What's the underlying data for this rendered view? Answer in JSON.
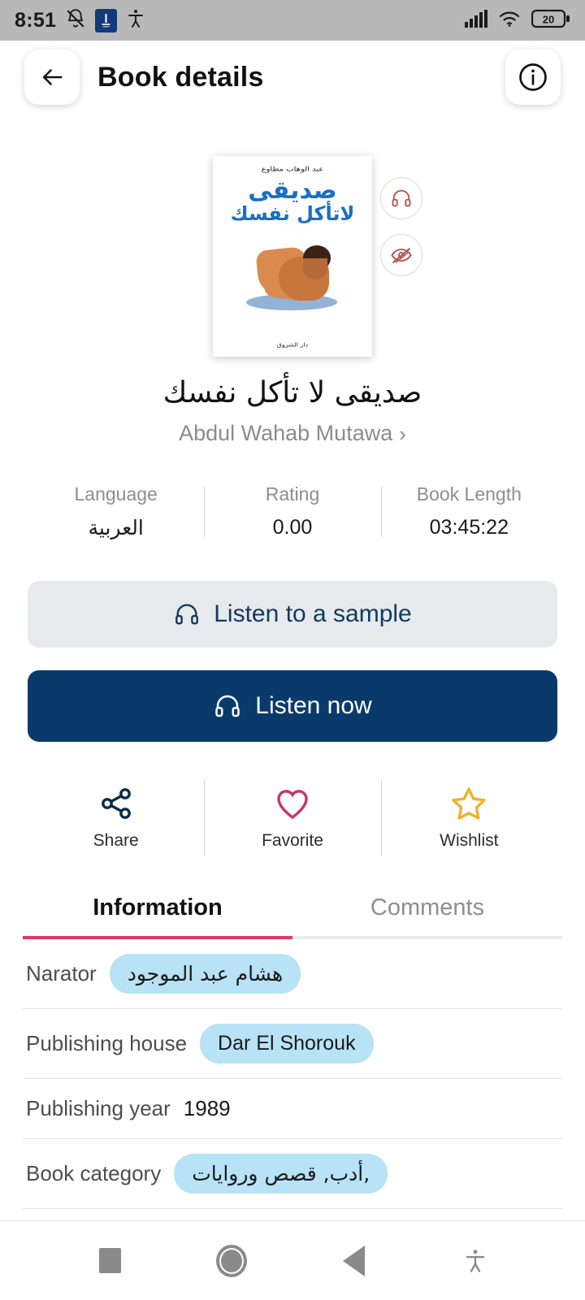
{
  "statusbar": {
    "time": "8:51",
    "icons": [
      "bell-muted-icon",
      "app-badge-icon",
      "accessibility-icon"
    ],
    "signal_icon": "cellular-signal-icon",
    "wifi_icon": "wifi-icon",
    "battery_level": "20"
  },
  "header": {
    "back_icon": "back-arrow-icon",
    "title": "Book details",
    "info_icon": "info-icon"
  },
  "cover": {
    "author_line": "عبد الوهاب مطاوع",
    "title_line1": "صديقى",
    "title_line2": "لاتأكل نفسك",
    "publisher_line": "دار الشروق",
    "side_actions": [
      {
        "name": "headphones-icon",
        "label": "audio-available"
      },
      {
        "name": "eye-off-icon",
        "label": "hide-preview"
      }
    ]
  },
  "book": {
    "title": "صديقى لا تأكل نفسك",
    "author": "Abdul Wahab Mutawa",
    "author_chevron": "›"
  },
  "stats": [
    {
      "label": "Language",
      "value": "العربية"
    },
    {
      "label": "Rating",
      "value": "0.00"
    },
    {
      "label": "Book Length",
      "value": "03:45:22"
    }
  ],
  "buttons": {
    "sample": {
      "label": "Listen to a sample",
      "icon": "headphones-icon"
    },
    "now": {
      "label": "Listen now",
      "icon": "headphones-icon"
    }
  },
  "actions": [
    {
      "label": "Share",
      "icon": "share-icon",
      "color": "#0d2b4a"
    },
    {
      "label": "Favorite",
      "icon": "heart-icon",
      "color": "#c9346b"
    },
    {
      "label": "Wishlist",
      "icon": "star-icon",
      "color": "#efb033"
    }
  ],
  "tabs": [
    {
      "label": "Information",
      "active": true
    },
    {
      "label": "Comments",
      "active": false
    }
  ],
  "info_rows": [
    {
      "label": "Narator",
      "value": "هشام عبد الموجود",
      "type": "chip"
    },
    {
      "label": "Publishing house",
      "value": "Dar El Shorouk",
      "type": "chip-ltr"
    },
    {
      "label": "Publishing year",
      "value": "1989",
      "type": "text"
    },
    {
      "label": "Book category",
      "value": "أدب, قصص وروايات,",
      "type": "chip"
    }
  ],
  "navbar": [
    {
      "name": "recents-button"
    },
    {
      "name": "home-button"
    },
    {
      "name": "back-button"
    },
    {
      "name": "accessibility-button"
    }
  ],
  "colors": {
    "primary": "#0a3a6b",
    "accent": "#e0396b",
    "chip": "#b8e2f5",
    "sample_bg": "#e7eaec"
  }
}
